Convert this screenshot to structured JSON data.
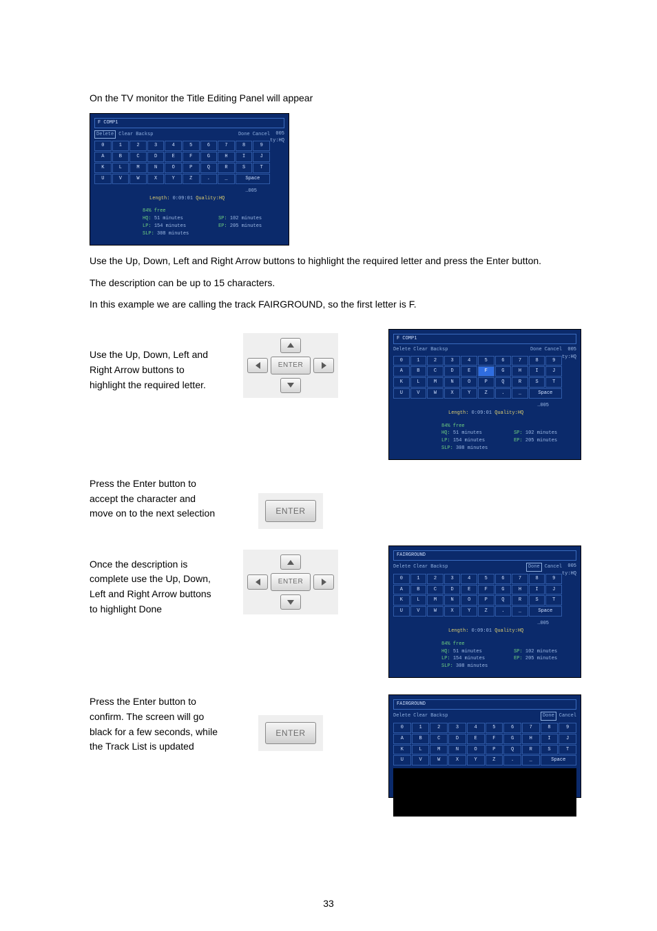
{
  "intro": {
    "line1": "On the TV monitor the Title Editing Panel will appear"
  },
  "after_first_shot": {
    "l1": "Use the Up, Down, Left and Right Arrow buttons to highlight the required letter and press the Enter button.",
    "l2": "The description can be up to 15 characters.",
    "l3": "In this example we are calling the track FAIRGROUND, so the first letter is F."
  },
  "steps": {
    "s1": "Use the Up, Down, Left and Right Arrow buttons to highlight the required letter.",
    "s2": "Press the Enter button to accept the character and move on to the next selection",
    "s3": "Once the description is complete use the Up, Down, Left and Right Arrow buttons to highlight Done",
    "s4": "Press the Enter button to confirm. The screen will go black for a few seconds, while the Track List is updated"
  },
  "remote": {
    "enter": "ENTER"
  },
  "tv": {
    "actions": {
      "delete": "Delete",
      "clear": "Clear",
      "backsp": "Backsp",
      "done": "Done",
      "cancel": "Cancel"
    },
    "side": {
      "l1": "005",
      "l2": "ty:HQ"
    },
    "keys_row1": [
      "0",
      "1",
      "2",
      "3",
      "4",
      "5",
      "6",
      "7",
      "8",
      "9"
    ],
    "keys_row2": [
      "A",
      "B",
      "C",
      "D",
      "E",
      "F",
      "G",
      "H",
      "I",
      "J"
    ],
    "keys_row3": [
      "K",
      "L",
      "M",
      "N",
      "O",
      "P",
      "Q",
      "R",
      "S",
      "T"
    ],
    "keys_row4": [
      "U",
      "V",
      "W",
      "X",
      "Y",
      "Z",
      ".",
      "_"
    ],
    "space": "Space",
    "info_l1": "…005",
    "info_l2a": "Length:",
    "info_l2b": "0:09:01",
    "info_l2c": "Quality:HQ",
    "stats_head": "84% free",
    "stats": {
      "hq": "HQ:  51 minutes",
      "sp": "SP: 102 minutes",
      "lp": "LP: 154 minutes",
      "ep": "EP: 205 minutes",
      "slp": "SLP: 308 minutes"
    },
    "titles": {
      "t1": "F COMP1",
      "t2": "FAIRGROUND"
    }
  },
  "highlight_index": {
    "shot1": -1,
    "shot2": 15,
    "shot3": -1
  },
  "done_boxed": {
    "shot3": true,
    "shot4": true
  },
  "page_num": "33"
}
